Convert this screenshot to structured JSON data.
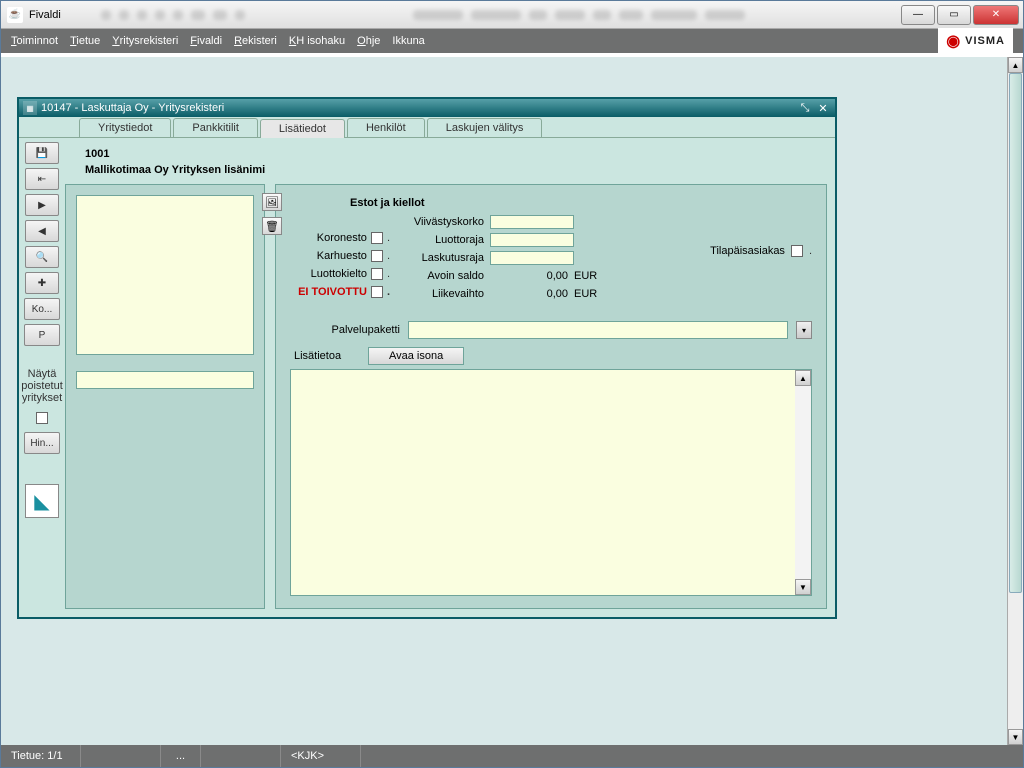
{
  "outer": {
    "title": "Fivaldi",
    "logo_text": "VISMA"
  },
  "menu": {
    "toiminnot": "Toiminnot",
    "tietue": "Tietue",
    "yritysrekisteri": "Yritysrekisteri",
    "fivaldi": "Fivaldi",
    "rekisteri": "Rekisteri",
    "khisohaku": "KH isohaku",
    "ohje": "Ohje",
    "ikkuna": "Ikkuna"
  },
  "inner": {
    "title": "10147 - Laskuttaja Oy - Yritysrekisteri"
  },
  "tabs": {
    "yritystiedot": "Yritystiedot",
    "pankkitilit": "Pankkitilit",
    "lisatiedot": "Lisätiedot",
    "henkilot": "Henkilöt",
    "laskujen_valitys": "Laskujen välitys"
  },
  "toolbar": {
    "ko": "Ko...",
    "p": "P",
    "hin": "Hin..."
  },
  "sidebar": {
    "show_deleted_l1": "Näytä",
    "show_deleted_l2": "poistetut",
    "show_deleted_l3": "yritykset"
  },
  "header": {
    "code": "1001",
    "name": "Mallikotimaa Oy Yrityksen lisänimi"
  },
  "form": {
    "section_title": "Estot ja kiellot",
    "koronesto": "Koronesto",
    "karhuesto": "Karhuesto",
    "luottokielto": "Luottokielto",
    "ei_toivottu": "EI TOIVOTTU",
    "viivastyskorko": "Viivästyskorko",
    "luottoraja": "Luottoraja",
    "laskutusraja": "Laskutusraja",
    "avoin_saldo": "Avoin saldo",
    "liikevaihto": "Liikevaihto",
    "avoin_saldo_val": "0,00",
    "liikevaihto_val": "0,00",
    "currency": "EUR",
    "tilapaisasiakas": "Tilapäisasiakas",
    "palvelupaketti": "Palvelupaketti",
    "lisatietoa": "Lisätietoa",
    "avaa_isona": "Avaa isona"
  },
  "status": {
    "tietue": "Tietue: 1/1",
    "dots": "...",
    "kjk": "<KJK>"
  }
}
